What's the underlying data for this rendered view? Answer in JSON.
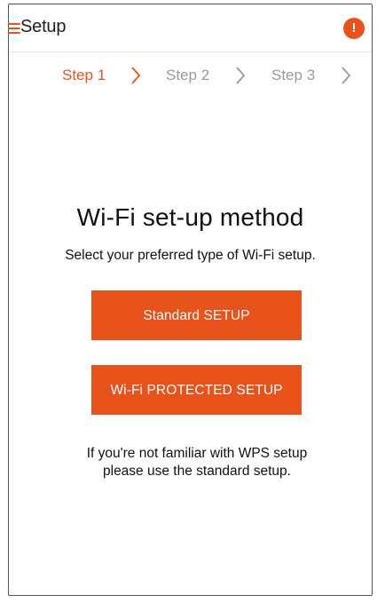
{
  "header": {
    "title": "Setup",
    "info_icon_glyph": "!"
  },
  "steps": [
    {
      "label": "Step 1",
      "active": true
    },
    {
      "label": "Step 2",
      "active": false
    },
    {
      "label": "Step 3",
      "active": false
    }
  ],
  "main": {
    "heading": "Wi-Fi set-up method",
    "subheading": "Select your preferred type of Wi-Fi setup.",
    "standard_button_label": "Standard SETUP",
    "wps_button_label": "Wi-Fi PROTECTED SETUP",
    "note": "If you're not familiar with WPS setup please use the standard setup."
  },
  "colors": {
    "accent": "#e8531c",
    "step_inactive": "#9a9a9a",
    "text": "#111111"
  },
  "icons": [
    "menu-icon",
    "info-icon",
    "chevron-right-icon"
  ]
}
